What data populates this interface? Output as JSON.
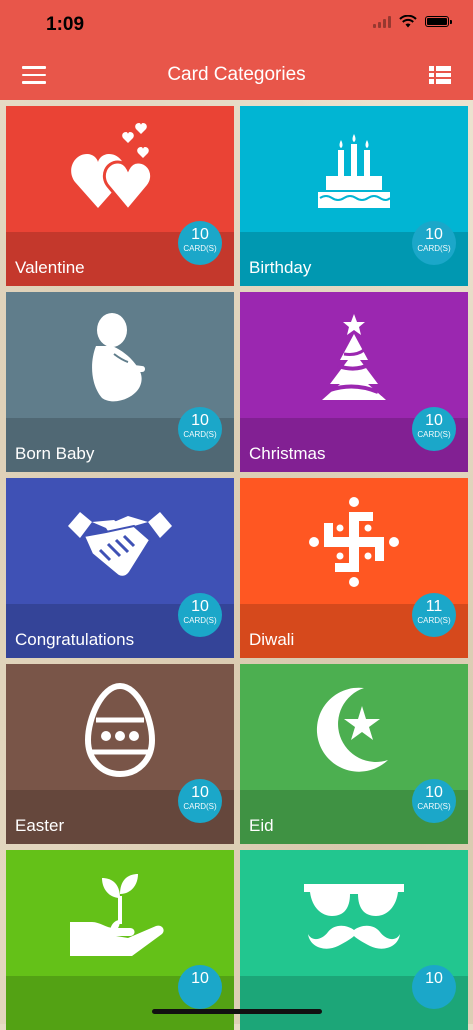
{
  "status": {
    "time": "1:09"
  },
  "header": {
    "title": "Card Categories"
  },
  "tiles": [
    {
      "label": "Valentine",
      "count": "10",
      "unit": "CARD(S)",
      "color": "#ea4335",
      "icon": "hearts-icon"
    },
    {
      "label": "Birthday",
      "count": "10",
      "unit": "CARD(S)",
      "color": "#01b5d3",
      "icon": "birthday-cake-icon"
    },
    {
      "label": "Born Baby",
      "count": "10",
      "unit": "CARD(S)",
      "color": "#607d8b",
      "icon": "baby-icon"
    },
    {
      "label": "Christmas",
      "count": "10",
      "unit": "CARD(S)",
      "color": "#9b27b0",
      "icon": "christmas-tree-icon"
    },
    {
      "label": "Congratulations",
      "count": "10",
      "unit": "CARD(S)",
      "color": "#3f51b5",
      "icon": "handshake-icon"
    },
    {
      "label": "Diwali",
      "count": "11",
      "unit": "CARD(S)",
      "color": "#ff5722",
      "icon": "swastika-icon"
    },
    {
      "label": "Easter",
      "count": "10",
      "unit": "CARD(S)",
      "color": "#795548",
      "icon": "easter-egg-icon"
    },
    {
      "label": "Eid",
      "count": "10",
      "unit": "CARD(S)",
      "color": "#4caf50",
      "icon": "crescent-star-icon"
    },
    {
      "label": "",
      "count": "10",
      "unit": "",
      "color": "#64c118",
      "icon": "plant-in-hand-icon"
    },
    {
      "label": "",
      "count": "10",
      "unit": "",
      "color": "#22c68f",
      "icon": "glasses-mustache-icon"
    }
  ]
}
